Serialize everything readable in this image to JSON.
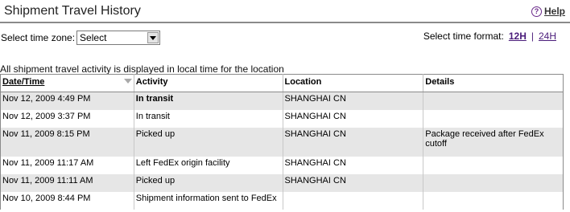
{
  "header": {
    "title": "Shipment Travel History",
    "help_label": "Help",
    "help_icon": "question-circle-icon"
  },
  "timezone": {
    "label": "Select time zone:",
    "selected": "Select"
  },
  "time_format": {
    "label": "Select time format:",
    "options": [
      "12H",
      "24H"
    ],
    "separator": "|",
    "active": "12H"
  },
  "note": "All shipment travel activity is displayed in local time for the location",
  "table": {
    "headers": [
      "Date/Time",
      "Activity",
      "Location",
      "Details"
    ],
    "rows": [
      {
        "datetime": "Nov 12, 2009 4:49 PM",
        "activity": "In transit",
        "location": "SHANGHAI CN",
        "details": ""
      },
      {
        "datetime": "Nov 12, 2009 3:37 PM",
        "activity": "In transit",
        "location": "SHANGHAI CN",
        "details": ""
      },
      {
        "datetime": "Nov 11, 2009 8:15 PM",
        "activity": "Picked up",
        "location": "SHANGHAI CN",
        "details": "Package received after FedEx cutoff"
      },
      {
        "datetime": "Nov 11, 2009 11:17 AM",
        "activity": "Left FedEx origin facility",
        "location": "SHANGHAI CN",
        "details": ""
      },
      {
        "datetime": "Nov 11, 2009 11:11 AM",
        "activity": "Picked up",
        "location": "SHANGHAI CN",
        "details": ""
      },
      {
        "datetime": "Nov 10, 2009 8:44 PM",
        "activity": "Shipment information sent to FedEx",
        "location": "",
        "details": ""
      }
    ]
  },
  "colors": {
    "link": "#4a1c7a",
    "row_shade": "#e6e6e6"
  }
}
